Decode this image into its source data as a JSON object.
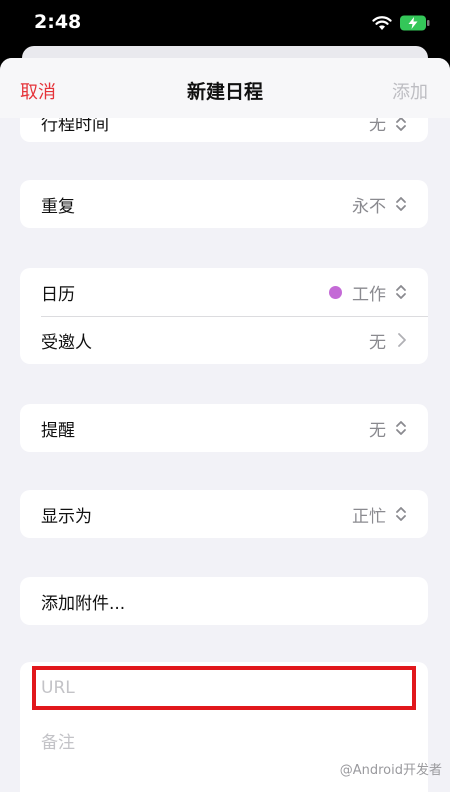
{
  "status_bar": {
    "time": "2:48"
  },
  "nav": {
    "cancel": "取消",
    "title": "新建日程",
    "add": "添加"
  },
  "rows": {
    "travel_time": {
      "label": "行程时间",
      "value": "无"
    },
    "repeat": {
      "label": "重复",
      "value": "永不"
    },
    "calendar": {
      "label": "日历",
      "value": "工作",
      "dot_color": "#c46ad6"
    },
    "invitees": {
      "label": "受邀人",
      "value": "无"
    },
    "alert": {
      "label": "提醒",
      "value": "无"
    },
    "show_as": {
      "label": "显示为",
      "value": "正忙"
    },
    "attachment": {
      "label": "添加附件..."
    }
  },
  "fields": {
    "url_placeholder": "URL",
    "notes_placeholder": "备注"
  },
  "watermark": "@Android开发者"
}
